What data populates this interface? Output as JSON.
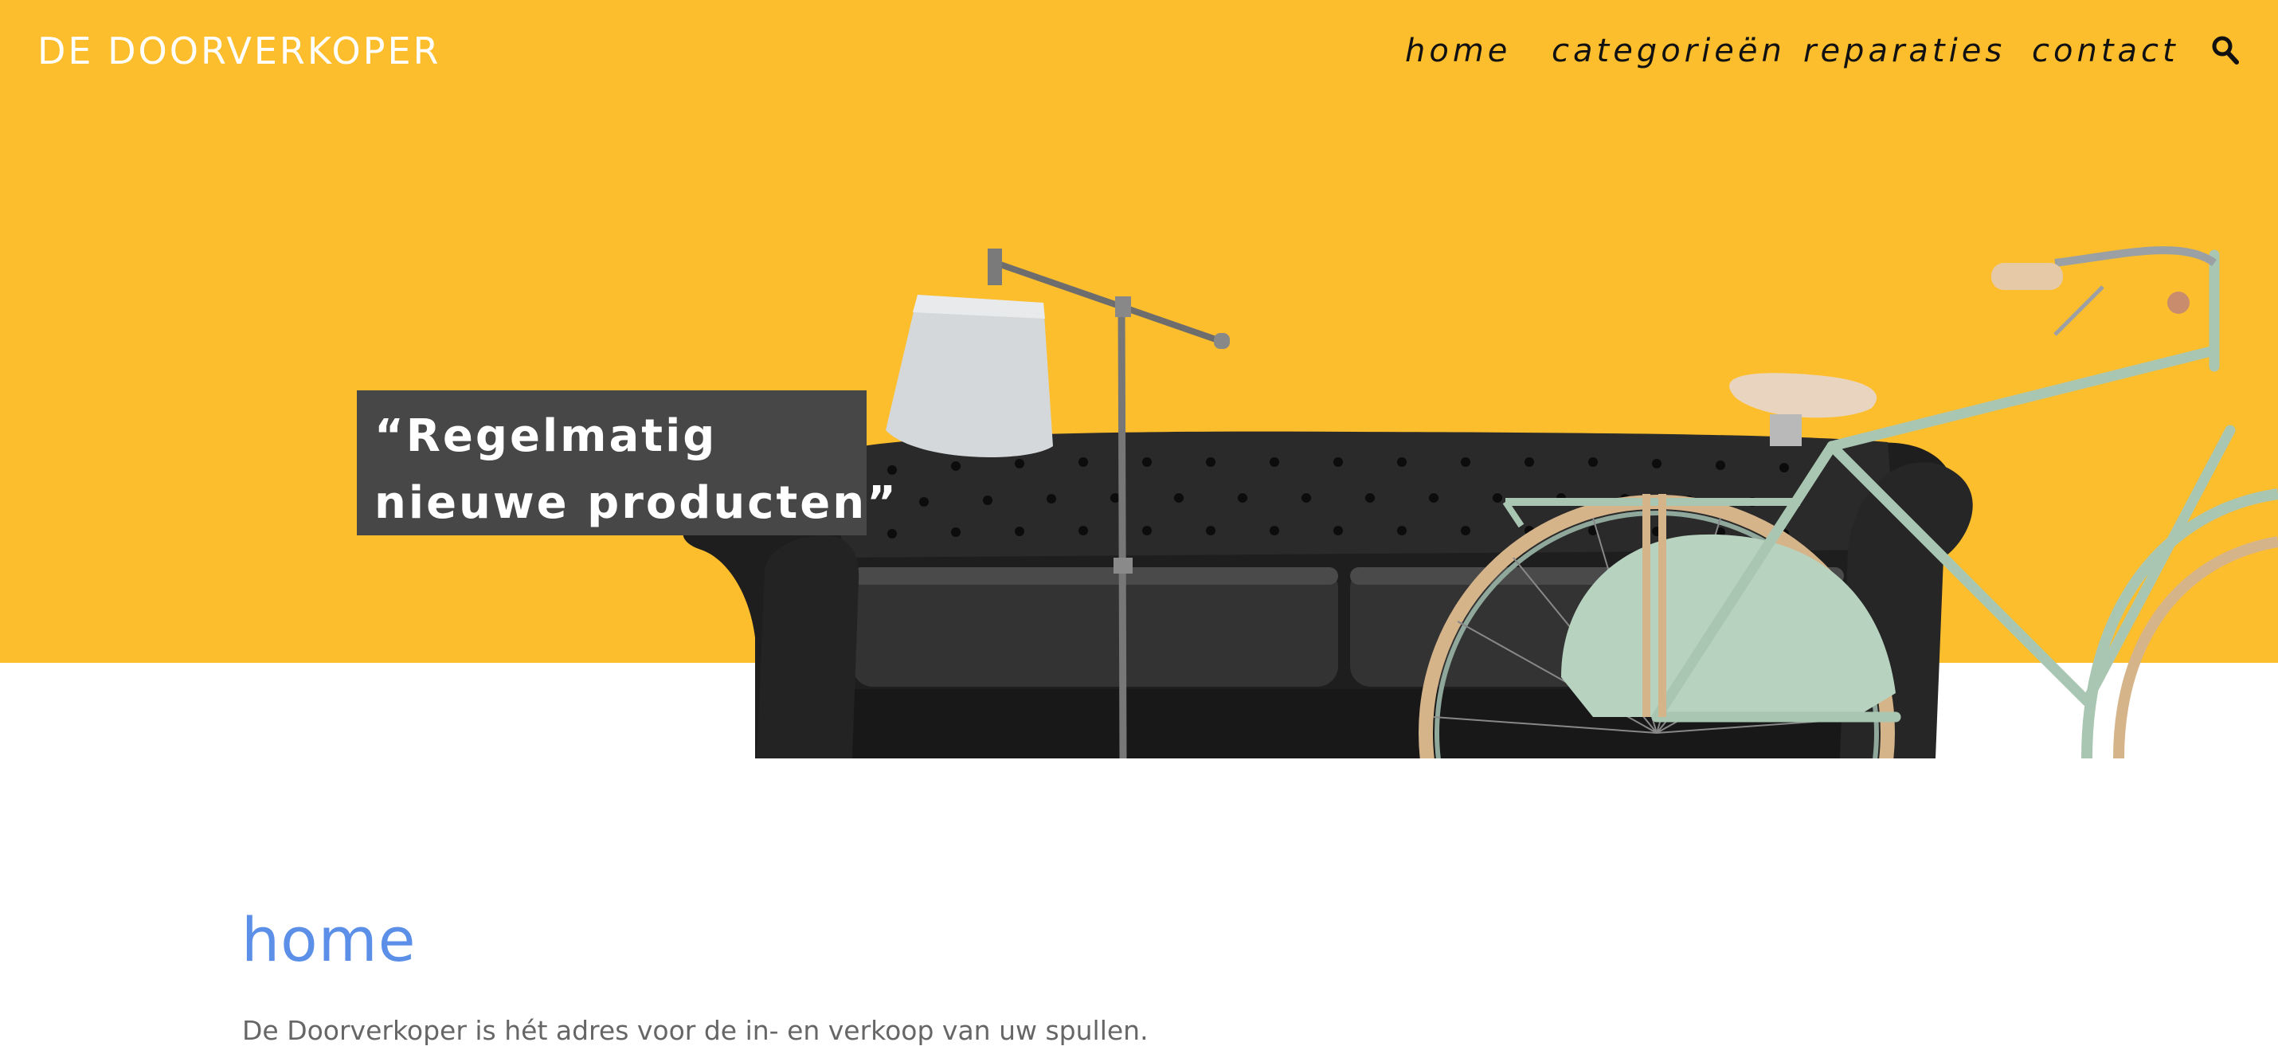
{
  "header": {
    "logo_text": "DE DOORVERKOPER",
    "nav": {
      "home": "home",
      "categories": "categorieën",
      "repairs": "reparaties",
      "contact": "contact"
    },
    "search_icon": "search-icon"
  },
  "hero": {
    "quote_line1": "“Regelmatig",
    "quote_line2": "nieuwe producten”",
    "background_color": "#FDBE2D",
    "image_contents": [
      "black leather chesterfield sofa",
      "floor lamp",
      "mint green bicycle"
    ]
  },
  "main": {
    "title": "home",
    "intro": "De Doorverkoper is hét adres voor de in- en verkoop van uw spullen."
  },
  "colors": {
    "accent_yellow": "#FDBE2D",
    "title_blue": "#5B8FE8",
    "quote_bg": "#474747"
  }
}
